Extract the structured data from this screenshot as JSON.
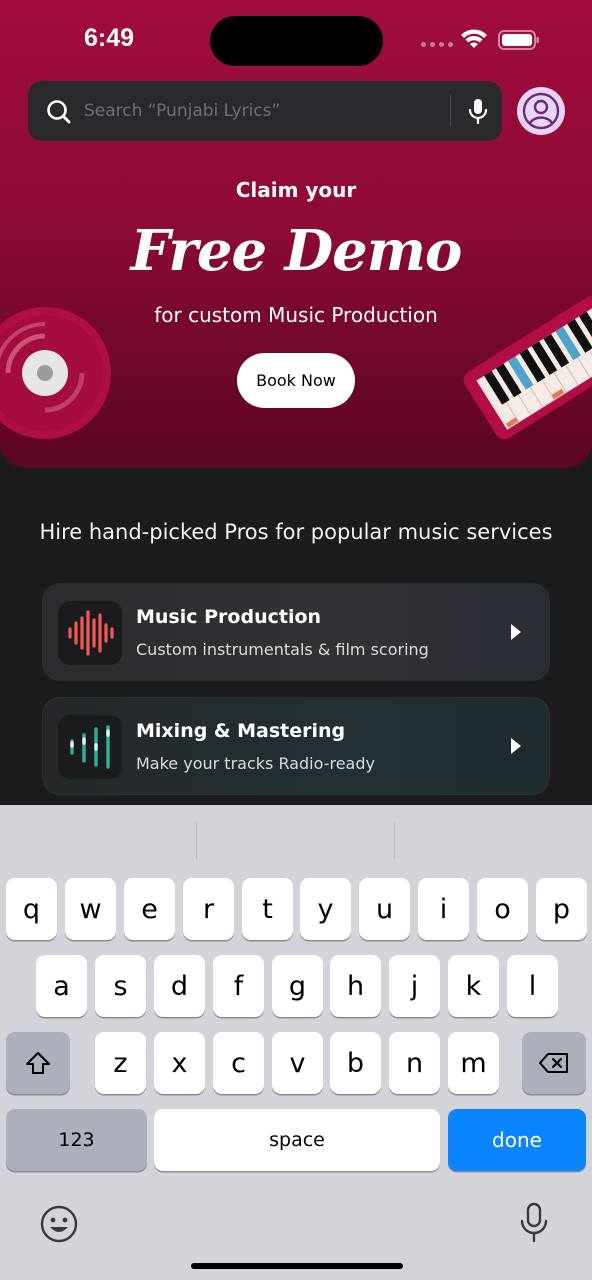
{
  "status_bar": {
    "time": "6:49"
  },
  "search": {
    "placeholder": "Search “Punjabi Lyrics”"
  },
  "hero": {
    "claim": "Claim your",
    "headline": "Free Demo",
    "subline": "for custom Music Production",
    "button_label": "Book Now"
  },
  "pros_heading": "Hire hand-picked Pros for popular music services",
  "services": [
    {
      "title": "Music Production",
      "subtitle": "Custom instrumentals & film scoring",
      "icon": "waveform-icon",
      "icon_color": "#ef5a57"
    },
    {
      "title": "Mixing & Mastering",
      "subtitle": "Make your tracks Radio-ready",
      "icon": "equalizer-icon",
      "icon_color": "#2bb39f"
    }
  ],
  "keyboard": {
    "row1": [
      "q",
      "w",
      "e",
      "r",
      "t",
      "y",
      "u",
      "i",
      "o",
      "p"
    ],
    "row2": [
      "a",
      "s",
      "d",
      "f",
      "g",
      "h",
      "j",
      "k",
      "l"
    ],
    "row3": [
      "z",
      "x",
      "c",
      "v",
      "b",
      "n",
      "m"
    ],
    "numbers_label": "123",
    "space_label": "space",
    "done_label": "done"
  },
  "colors": {
    "accent": "#0a84ff",
    "hero_primary": "#a00c3e"
  }
}
